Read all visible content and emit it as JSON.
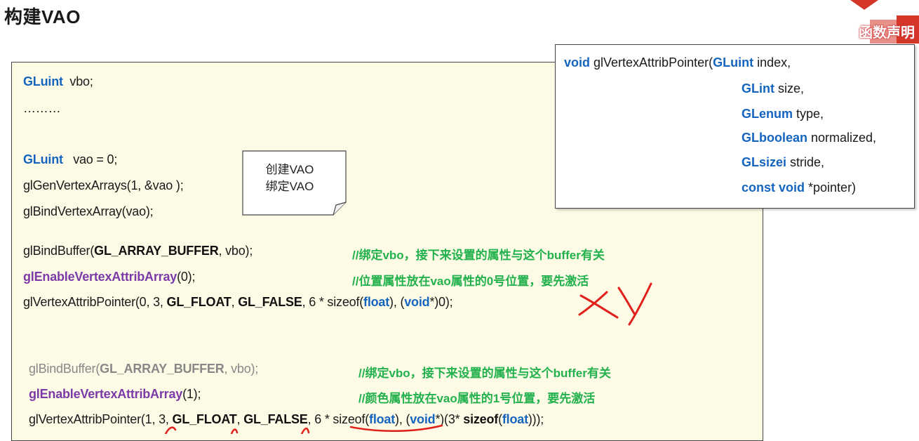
{
  "title": "构建VAO",
  "corner": {
    "label": "函数声明"
  },
  "code": {
    "l1": {
      "type": "GLuint",
      "rest": "  vbo;"
    },
    "l2": {
      "text": "………"
    },
    "l3": {
      "type": "GLuint",
      "rest": "   vao = 0;"
    },
    "l4": {
      "text": "glGenVertexArrays(1, &vao );"
    },
    "l5": {
      "text": "glBindVertexArray(vao);"
    },
    "l6": {
      "pre": "glBindBuffer(",
      "const": "GL_ARRAY_BUFFER",
      "post": ", vbo);",
      "comment": "//绑定vbo，接下来设置的属性与这个buffer有关"
    },
    "l7": {
      "fn": "glEnableVertexAttribArray",
      "post": "(0);",
      "comment": "//位置属性放在vao属性的0号位置，要先激活"
    },
    "l8": {
      "pre": "glVertexAttribPointer(0, 3, ",
      "c1": "GL_FLOAT",
      "mid": ", ",
      "c2": "GL_FALSE",
      "mid2": ", 6 * sizeof(",
      "kw1": "float",
      "mid3": "), (",
      "kw2": "void",
      "post": "*)0);"
    },
    "l9": {
      "pre": "glBindBuffer(",
      "const": "GL_ARRAY_BUFFER",
      "post": ", vbo);",
      "comment": "//绑定vbo，接下来设置的属性与这个buffer有关"
    },
    "l10": {
      "fn": "glEnableVertexAttribArray",
      "post": "(1);",
      "comment": "//颜色属性放在vao属性的1号位置，要先激活"
    },
    "l11": {
      "pre": "glVertexAttribPointer(1, 3, ",
      "c1": "GL_FLOAT",
      "mid": ", ",
      "c2": "GL_FALSE",
      "mid2": ", 6 * sizeof(",
      "kw1": "float",
      "mid3": "), (",
      "kw2": "void",
      "mid4": "*)(3* ",
      "kw3": "sizeof",
      "mid5": "(",
      "kw4": "float",
      "post": ")));"
    }
  },
  "note": {
    "line1": "创建VAO",
    "line2": "绑定VAO"
  },
  "decl": {
    "kw_void": "void",
    "fn": " glVertexAttribPointer(",
    "p1_type": "GLuint",
    "p1_name": " index,",
    "p2_type": "GLint",
    "p2_name": " size,",
    "p3_type": "GLenum",
    "p3_name": " type,",
    "p4_type": "GLboolean",
    "p4_name": " normalized,",
    "p5_type": "GLsizei",
    "p5_name": " stride,",
    "p6_type": "const void",
    "p6_name": " *pointer)"
  },
  "annotation": {
    "marks": [
      "X",
      "Y"
    ],
    "ink_color": "#e0201b"
  },
  "colors": {
    "keyword": "#1565c0",
    "function": "#7b3aa8",
    "comment": "#22b14c",
    "panel": "#fdfbe6"
  }
}
